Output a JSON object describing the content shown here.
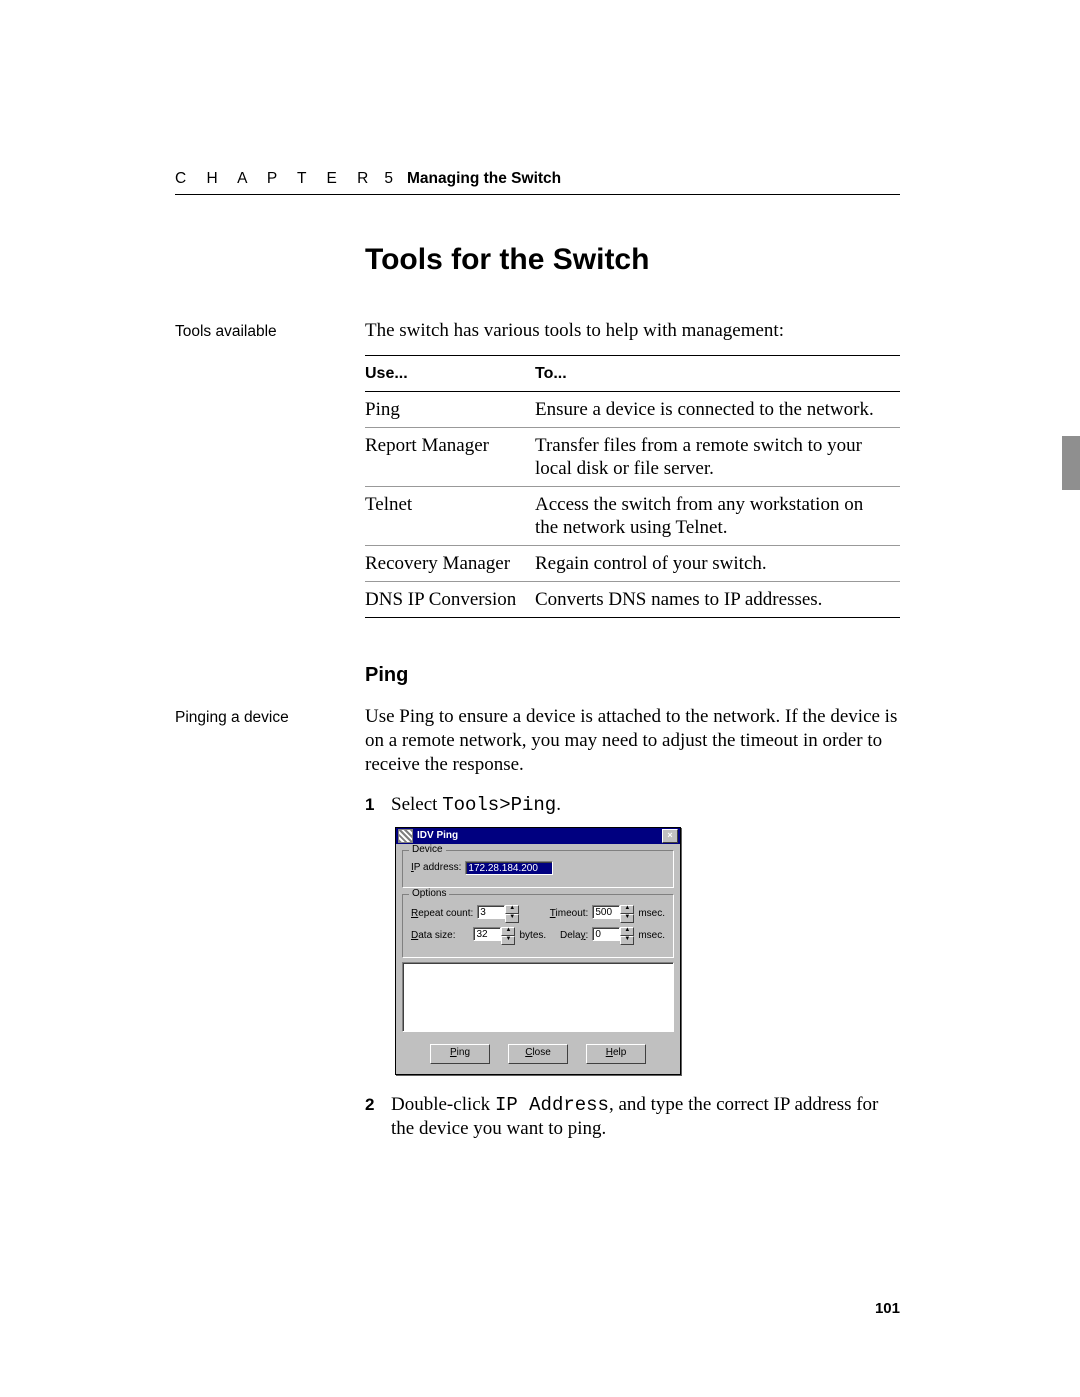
{
  "header": {
    "chapter_word": "C H A P T E R",
    "chapter_num": "5",
    "chapter_title": "Managing the Switch"
  },
  "main_heading": "Tools for the Switch",
  "section1": {
    "sidenote": "Tools available",
    "intro": "The switch has various tools to help with management:",
    "table": {
      "head_use": "Use...",
      "head_to": "To...",
      "rows": [
        {
          "use": "Ping",
          "to": "Ensure a device is connected to the net­work."
        },
        {
          "use": "Report Manager",
          "to": "Transfer files from a remote switch to your local disk or file server."
        },
        {
          "use": "Telnet",
          "to": "Access the switch from any workstation on the network using Telnet."
        },
        {
          "use": "Recovery Manager",
          "to": "Regain control of your switch."
        },
        {
          "use": "DNS IP Conversion",
          "to": "Converts DNS names to IP addresses."
        }
      ]
    }
  },
  "sub_heading": "Ping",
  "section2": {
    "sidenote": "Pinging a device",
    "intro": "Use Ping to ensure a device is attached to the network. If the device is on a remote network, you may need to adjust the timeout in order to receive the response.",
    "step1": {
      "num": "1",
      "lead": "Select ",
      "code": "Tools>Ping",
      "trail": "."
    },
    "step2": {
      "num": "2",
      "lead": "Double-click ",
      "code": "IP Address",
      "trail": ", and type the correct IP address for the device you want to ping."
    }
  },
  "dialog": {
    "title": "IDV Ping",
    "grp_device": "Device",
    "lbl_ip_u": "I",
    "lbl_ip_rest": "P address:",
    "ip_value": "172.28.184.200",
    "grp_options": "Options",
    "lbl_repeat_u": "R",
    "lbl_repeat_rest": "epeat count:",
    "repeat_value": "3",
    "lbl_timeout_u": "T",
    "lbl_timeout_rest": "imeout:",
    "timeout_value": "500",
    "unit_msec": "msec.",
    "lbl_data_u": "D",
    "lbl_data_rest": "ata size:",
    "data_value": "32",
    "unit_bytes": "bytes.",
    "lbl_delay_rest": "Dela",
    "lbl_delay_u": "y",
    "lbl_delay_end": ":",
    "delay_value": "0",
    "btn_ping_u": "P",
    "btn_ping_rest": "ing",
    "btn_close_u": "C",
    "btn_close_rest": "lose",
    "btn_help_u": "H",
    "btn_help_rest": "elp",
    "close_x": "×"
  },
  "page_number": "101"
}
